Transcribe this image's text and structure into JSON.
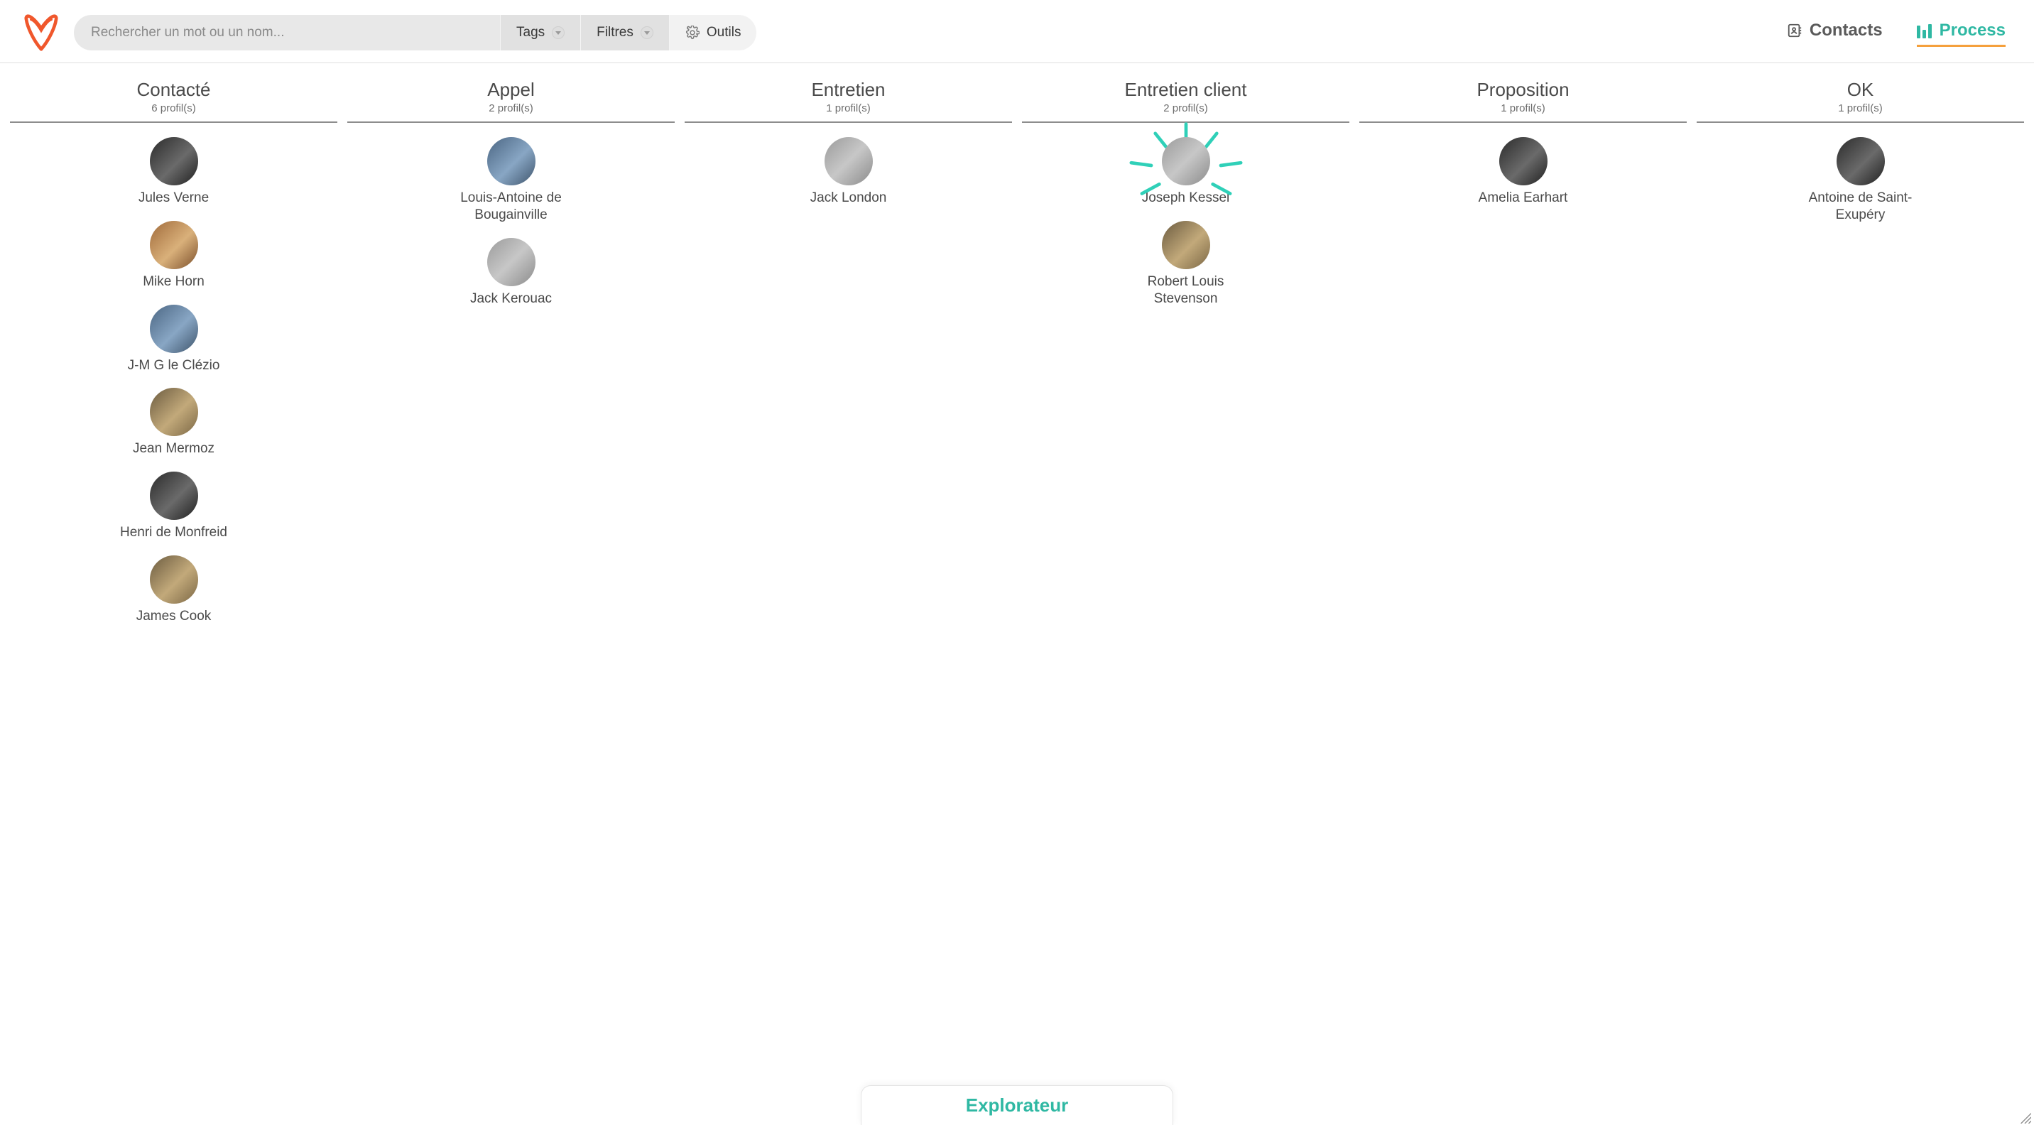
{
  "colors": {
    "accent": "#2fb8a3",
    "brand": "#f0572c"
  },
  "search": {
    "placeholder": "Rechercher un mot ou un nom..."
  },
  "toolbar": {
    "tags": "Tags",
    "filters": "Filtres",
    "tools": "Outils"
  },
  "nav": {
    "contacts": "Contacts",
    "process": "Process"
  },
  "profile_suffix": "profil(s)",
  "columns": [
    {
      "title": "Contacté",
      "count": 6,
      "cards": [
        {
          "name": "Jules Verne",
          "tone": "dark"
        },
        {
          "name": "Mike Horn",
          "tone": "warm"
        },
        {
          "name": "J-M G le Clézio",
          "tone": "blue"
        },
        {
          "name": "Jean Mermoz",
          "tone": "sepia"
        },
        {
          "name": "Henri de Monfreid",
          "tone": "dark"
        },
        {
          "name": "James Cook",
          "tone": "sepia"
        }
      ]
    },
    {
      "title": "Appel",
      "count": 2,
      "cards": [
        {
          "name": "Louis-Antoine de Bougainville",
          "tone": "blue"
        },
        {
          "name": "Jack Kerouac",
          "tone": "default"
        }
      ]
    },
    {
      "title": "Entretien",
      "count": 1,
      "cards": [
        {
          "name": "Jack London",
          "tone": "default"
        }
      ]
    },
    {
      "title": "Entretien client",
      "count": 2,
      "cards": [
        {
          "name": "Joseph Kessel",
          "tone": "default",
          "highlight": true
        },
        {
          "name": "Robert Louis Stevenson",
          "tone": "sepia"
        }
      ]
    },
    {
      "title": "Proposition",
      "count": 1,
      "cards": [
        {
          "name": "Amelia Earhart",
          "tone": "dark"
        }
      ]
    },
    {
      "title": "OK",
      "count": 1,
      "cards": [
        {
          "name": "Antoine de Saint-Exupéry",
          "tone": "dark"
        }
      ]
    }
  ],
  "bottom_tab": {
    "label": "Explorateur"
  }
}
